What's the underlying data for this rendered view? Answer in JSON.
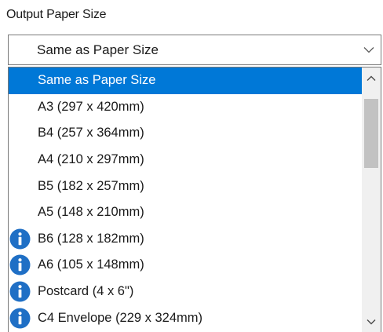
{
  "output_paper_size": {
    "label": "Output Paper Size",
    "selected_value": "Same as Paper Size",
    "options": [
      {
        "label": "Same as Paper Size",
        "selected": true,
        "icon": null
      },
      {
        "label": "A3 (297 x 420mm)",
        "selected": false,
        "icon": null
      },
      {
        "label": "B4 (257 x 364mm)",
        "selected": false,
        "icon": null
      },
      {
        "label": "A4 (210 x 297mm)",
        "selected": false,
        "icon": null
      },
      {
        "label": "B5 (182 x 257mm)",
        "selected": false,
        "icon": null
      },
      {
        "label": "A5 (148 x 210mm)",
        "selected": false,
        "icon": null
      },
      {
        "label": "B6 (128 x 182mm)",
        "selected": false,
        "icon": "info-icon"
      },
      {
        "label": "A6 (105 x 148mm)",
        "selected": false,
        "icon": "info-icon"
      },
      {
        "label": "Postcard (4 x 6\")",
        "selected": false,
        "icon": "info-icon"
      },
      {
        "label": "C4 Envelope (229 x 324mm)",
        "selected": false,
        "icon": "info-icon"
      }
    ]
  },
  "colors": {
    "selection": "#0078d7",
    "info_icon": "#1f6fc5",
    "scroll_track": "#f0f0f0",
    "scroll_thumb": "#c2c2c2",
    "border": "#7a7a7a"
  }
}
